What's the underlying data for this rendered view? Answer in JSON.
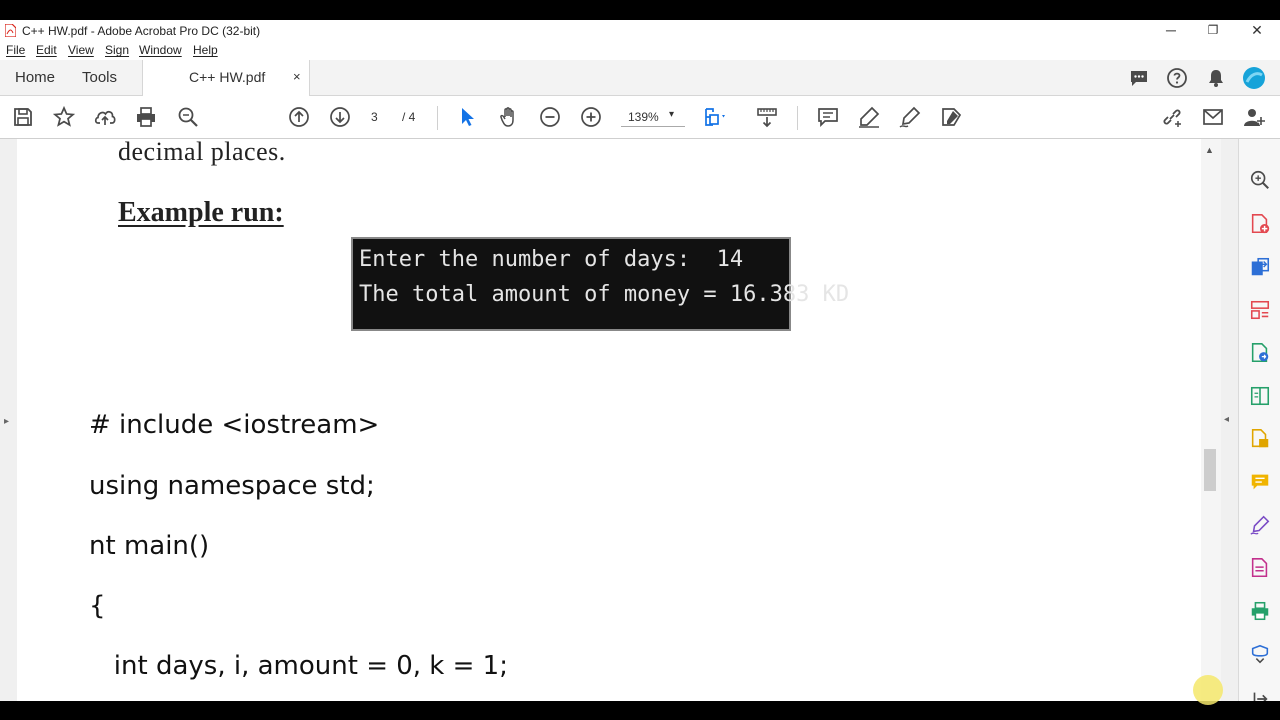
{
  "window": {
    "title": "C++ HW.pdf - Adobe Acrobat Pro DC (32-bit)",
    "controls": {
      "minimize": "─",
      "restore": "❐",
      "close": "✕"
    }
  },
  "menu": [
    "File",
    "Edit",
    "View",
    "Sign",
    "Window",
    "Help"
  ],
  "tabs": {
    "home": "Home",
    "tools": "Tools",
    "doc": "C++ HW.pdf",
    "close": "×"
  },
  "toolbar": {
    "page_current": "3",
    "page_total": "/ 4",
    "zoom": "139%",
    "zoom_caret": "▾"
  },
  "document": {
    "fragment": "decimal places.",
    "example_heading": "Example run:",
    "console_lines": [
      "Enter the number of days:  14",
      "The total amount of money = 16.383 KD"
    ],
    "code_lines": [
      "# include <iostream>",
      "using namespace std;",
      "nt main()",
      "{",
      "   int days, i, amount = 0, k = 1;"
    ]
  },
  "scroll": {
    "left_arrow": "▸",
    "right_arrow": "◂",
    "up_arrow": "▲"
  },
  "colors": {
    "accent_blue": "#1473e6",
    "icon_gray": "#4b4b4b",
    "acrobat_red": "#d9261c"
  }
}
